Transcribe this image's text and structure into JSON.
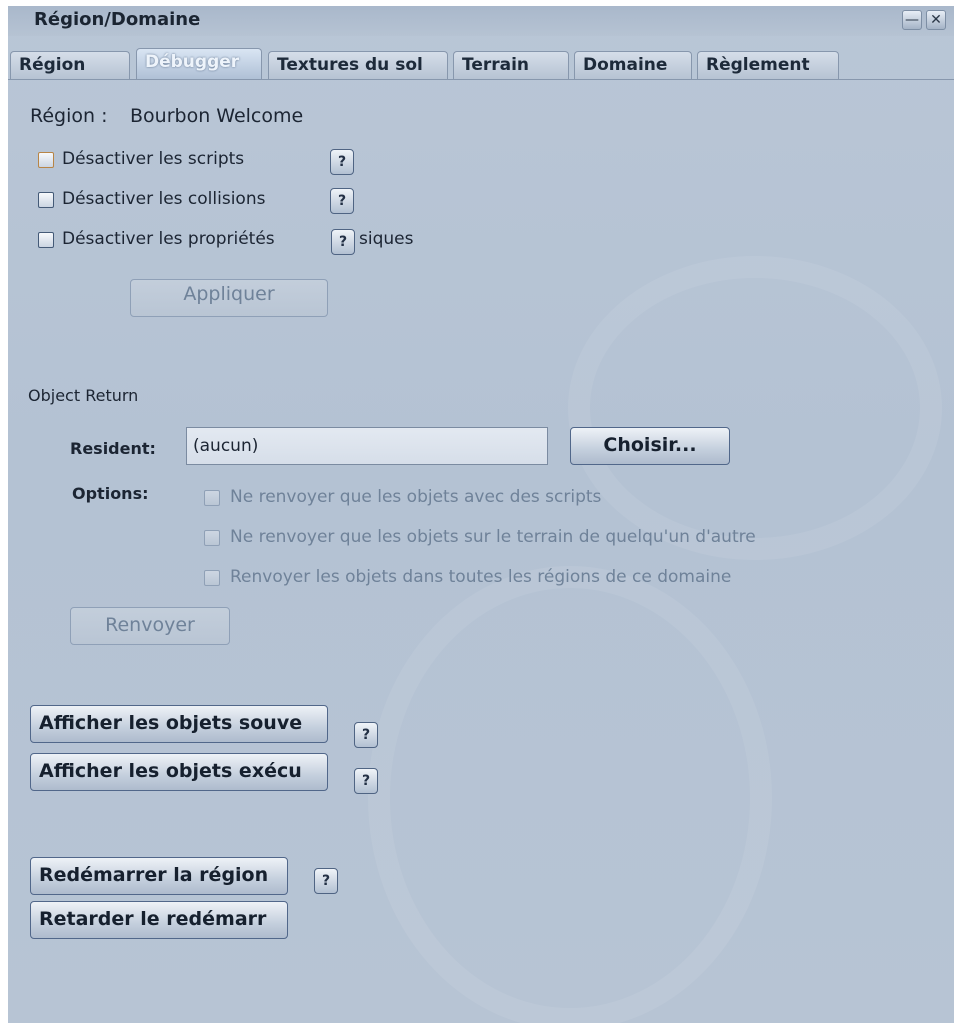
{
  "window": {
    "title": "Région/Domaine",
    "minimize_glyph": "—",
    "close_glyph": "✕"
  },
  "tabs": [
    {
      "label": "Région"
    },
    {
      "label": "Débugger"
    },
    {
      "label": "Textures du sol"
    },
    {
      "label": "Terrain"
    },
    {
      "label": "Domaine"
    },
    {
      "label": "Règlement"
    }
  ],
  "active_tab": "Débugger",
  "region": {
    "label": "Région :",
    "name": "Bourbon Welcome"
  },
  "options": {
    "disable_scripts": "Désactiver les scripts",
    "disable_collisions": "Désactiver les collisions",
    "disable_physics_left": "Désactiver les propriétés",
    "disable_physics_right": "siques"
  },
  "help_label": "?",
  "apply_button": "Appliquer",
  "object_return": {
    "heading": "Object Return",
    "resident_label": "Resident:",
    "resident_value": "(aucun)",
    "choose_button": "Choisir...",
    "options_label": "Options:",
    "opt_scripts": "Ne renvoyer que les objets avec des scripts",
    "opt_others_land": "Ne renvoyer que les objets sur le terrain de quelqu'un d'autre",
    "opt_all_regions": "Renvoyer les objets dans toutes les régions de ce domaine",
    "return_button": "Renvoyer"
  },
  "buttons": {
    "top_colliders": "Afficher les objets souve",
    "top_scripts": "Afficher les objets exécu",
    "restart_region": "Redémarrer la région",
    "delay_restart": "Retarder le redémarr"
  },
  "colors": {
    "panel": "#b7c4d4",
    "text": "#1c2533",
    "disabled_text": "#6f8299"
  }
}
